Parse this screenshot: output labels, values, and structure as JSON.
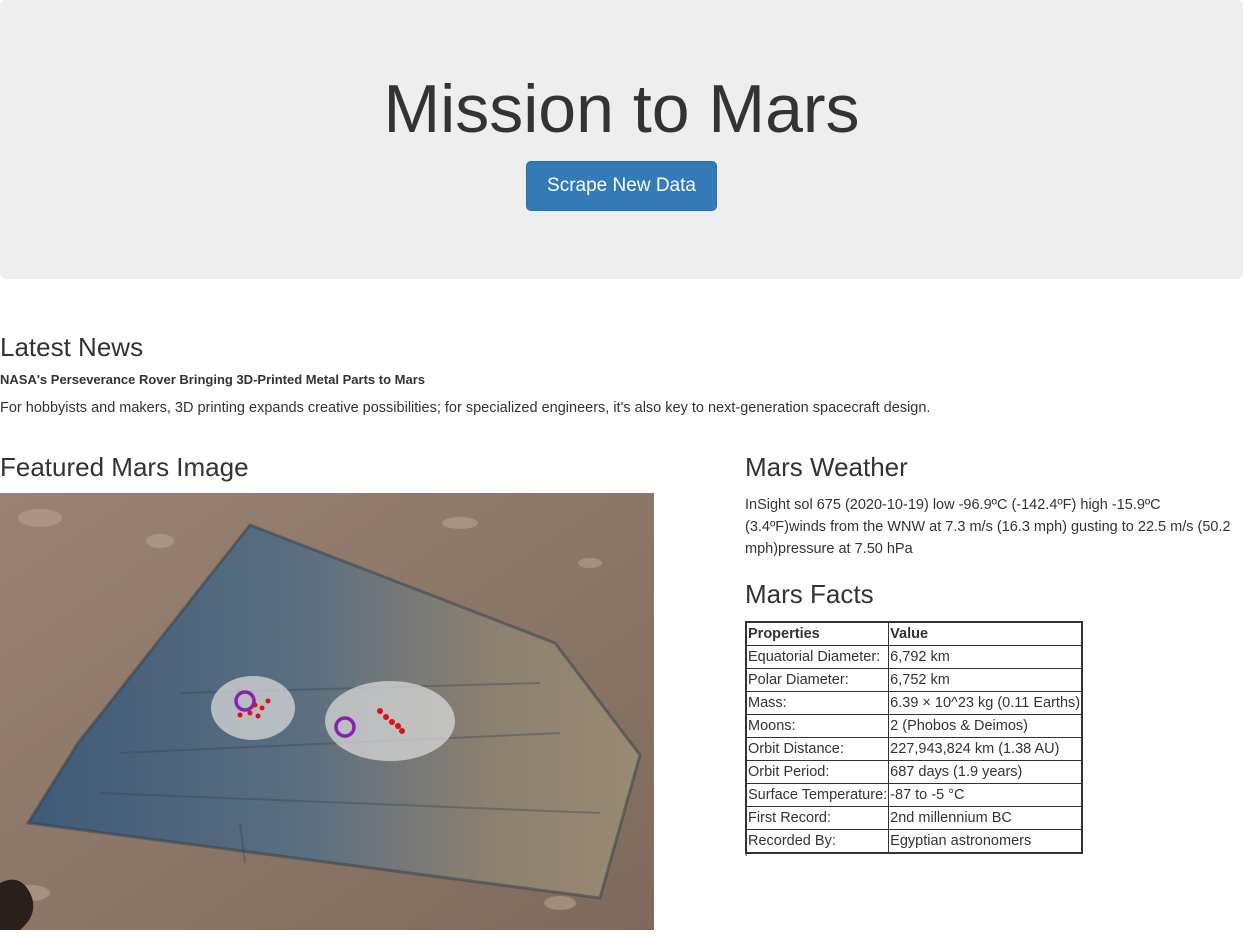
{
  "header": {
    "title": "Mission to Mars",
    "scrape_button_label": "Scrape New Data"
  },
  "news": {
    "heading": "Latest News",
    "title": "NASA's Perseverance Rover Bringing 3D-Printed Metal Parts to Mars",
    "paragraph": "For hobbyists and makers, 3D printing expands creative possibilities; for specialized engineers, it's also key to next-generation spacecraft design."
  },
  "featured_image": {
    "heading": "Featured Mars Image",
    "icon": "mars-rock-photo"
  },
  "weather": {
    "heading": "Mars Weather",
    "text": "InSight sol 675 (2020-10-19) low -96.9ºC (-142.4ºF) high -15.9ºC (3.4ºF)winds from the WNW at 7.3 m/s (16.3 mph) gusting to 22.5 m/s (50.2 mph)pressure at 7.50 hPa"
  },
  "facts": {
    "heading": "Mars Facts",
    "columns": [
      "Properties",
      "Value"
    ],
    "rows": [
      [
        "Equatorial Diameter:",
        "6,792 km"
      ],
      [
        "Polar Diameter:",
        "6,752 km"
      ],
      [
        "Mass:",
        "6.39 × 10^23 kg (0.11 Earths)"
      ],
      [
        "Moons:",
        "2 (Phobos & Deimos)"
      ],
      [
        "Orbit Distance:",
        "227,943,824 km (1.38 AU)"
      ],
      [
        "Orbit Period:",
        "687 days (1.9 years)"
      ],
      [
        "Surface Temperature:",
        "-87 to -5 °C"
      ],
      [
        "First Record:",
        "2nd millennium BC"
      ],
      [
        "Recorded By:",
        "Egyptian astronomers"
      ]
    ],
    "trailing_mark": "'"
  },
  "colors": {
    "button": "#337ab7",
    "jumbotron_bg": "#eeeeee",
    "text": "#333333"
  }
}
